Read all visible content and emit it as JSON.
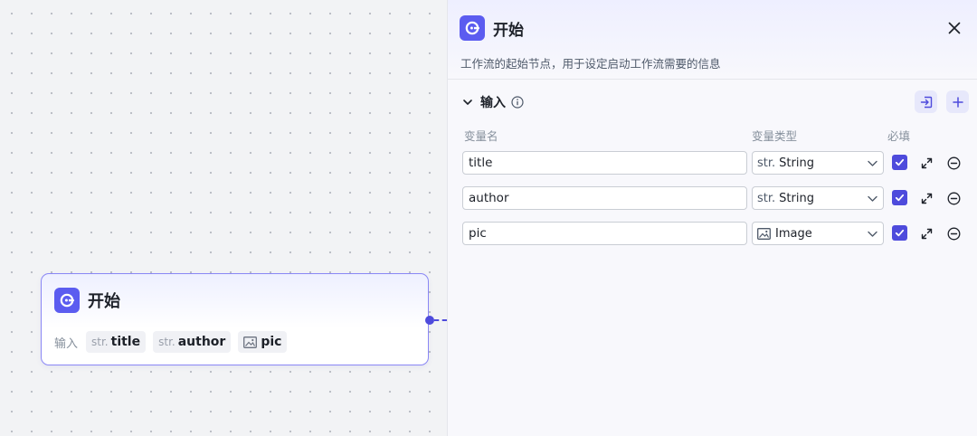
{
  "canvas": {
    "node": {
      "title": "开始",
      "inputs_label": "输入",
      "chips": [
        {
          "prefix": "str.",
          "name": "title",
          "icon": "string-icon"
        },
        {
          "prefix": "str.",
          "name": "author",
          "icon": "string-icon"
        },
        {
          "prefix": "",
          "name": "pic",
          "icon": "image-icon"
        }
      ]
    }
  },
  "panel": {
    "title": "开始",
    "description": "工作流的起始节点，用于设定启动工作流需要的信息",
    "section": {
      "title": "输入",
      "columns": {
        "name": "变量名",
        "type": "变量类型",
        "required": "必填"
      },
      "rows": [
        {
          "name": "title",
          "type_prefix": "str.",
          "type": "String",
          "required": true
        },
        {
          "name": "author",
          "type_prefix": "str.",
          "type": "String",
          "required": true
        },
        {
          "name": "pic",
          "type_prefix": "",
          "type": "Image",
          "required": true
        }
      ]
    }
  },
  "colors": {
    "accent": "#5b5cf0",
    "node_border": "#8a87f5",
    "check": "#4e4bdc"
  }
}
